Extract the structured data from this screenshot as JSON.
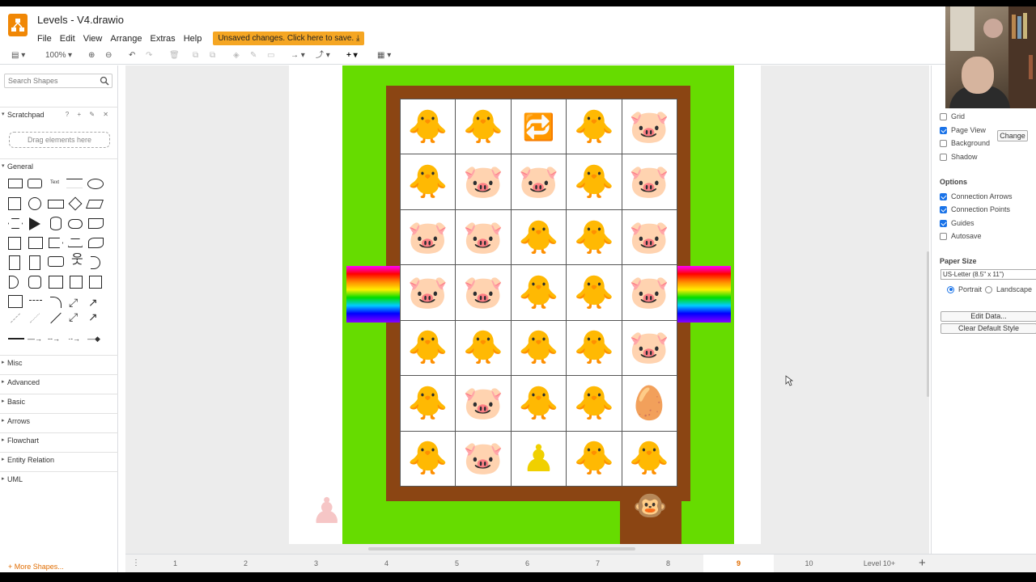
{
  "app": {
    "title": "Levels - V4.drawio",
    "unsaved_label": "Unsaved changes. Click here to save. ⤓",
    "menu": [
      "File",
      "Edit",
      "View",
      "Arrange",
      "Extras",
      "Help"
    ]
  },
  "toolbar": {
    "zoom": "100%"
  },
  "left_panel": {
    "search_placeholder": "Search Shapes",
    "scratchpad_title": "Scratchpad",
    "scratchpad_icons": "? + ✎ ✕",
    "drop_label": "Drag elements here",
    "sections": [
      "General",
      "Misc",
      "Advanced",
      "Basic",
      "Arrows",
      "Flowchart",
      "Entity Relation",
      "UML"
    ],
    "more_shapes": "+ More Shapes..."
  },
  "board": {
    "grid": [
      [
        "🐥",
        "🐥",
        "🔁",
        "🐥",
        "🐷"
      ],
      [
        "🐥",
        "🐷",
        "🐷",
        "🐥",
        "🐷"
      ],
      [
        "🐷",
        "🐷",
        "🐥",
        "🐥",
        "🐷"
      ],
      [
        "🐷",
        "🐷",
        "🐥",
        "🐥",
        "🐷"
      ],
      [
        "🐥",
        "🐥",
        "🐥",
        "🐥",
        "🐷"
      ],
      [
        "🐥",
        "🐷",
        "🐥",
        "🐥",
        "🥚"
      ],
      [
        "🐥",
        "🐷",
        "♟",
        "🐥",
        "🐥"
      ]
    ],
    "outside_piece": "♟",
    "exit_piece": "🐵",
    "colors": {
      "grass": "#66dc00",
      "wall": "#8b4513"
    }
  },
  "right_panel": {
    "view_checks": [
      {
        "label": "Grid",
        "checked": false
      },
      {
        "label": "Page View",
        "checked": true
      },
      {
        "label": "Background",
        "checked": false
      },
      {
        "label": "Shadow",
        "checked": false
      }
    ],
    "change_label": "Change",
    "options_title": "Options",
    "option_checks": [
      {
        "label": "Connection Arrows",
        "checked": true
      },
      {
        "label": "Connection Points",
        "checked": true
      },
      {
        "label": "Guides",
        "checked": true
      },
      {
        "label": "Autosave",
        "checked": false
      }
    ],
    "paper_size_title": "Paper Size",
    "paper_size_value": "US-Letter (8.5\" x 11\")",
    "orientation": {
      "portrait": "Portrait",
      "landscape": "Landscape",
      "selected": "portrait"
    },
    "edit_data": "Edit Data...",
    "clear_style": "Clear Default Style"
  },
  "pages": {
    "tabs": [
      "1",
      "2",
      "3",
      "4",
      "5",
      "6",
      "7",
      "8",
      "9",
      "10",
      "Level 10+"
    ],
    "active_index": 8
  }
}
